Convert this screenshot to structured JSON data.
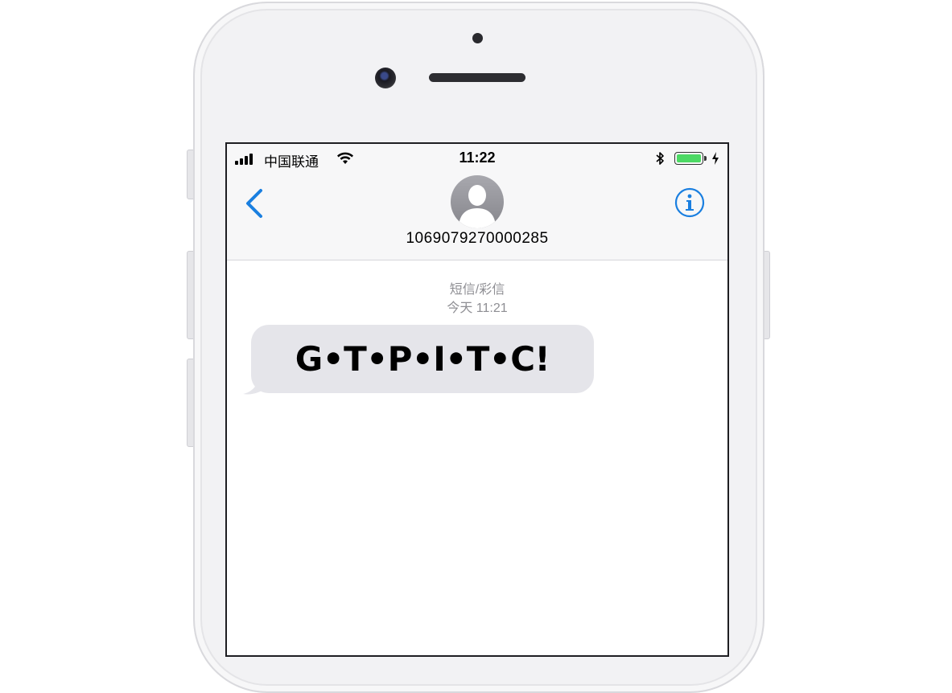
{
  "status_bar": {
    "carrier": "中国联通",
    "time": "11:22"
  },
  "header": {
    "contact_number": "1069079270000285"
  },
  "conversation": {
    "message_type": "短信/彩信",
    "timestamp": "今天 11:21",
    "messages": [
      {
        "text": "G•T•P•I•T•C!",
        "direction": "incoming"
      }
    ]
  },
  "colors": {
    "accent": "#1a7fe0",
    "bubble_incoming": "#e5e5ea",
    "battery": "#4cd964",
    "meta_text": "#8e8e93"
  },
  "icons": {
    "back": "chevron-left-icon",
    "info": "info-icon",
    "avatar": "person-silhouette-icon",
    "wifi": "wifi-icon",
    "bluetooth": "bluetooth-icon",
    "battery": "battery-icon",
    "charging": "bolt-icon",
    "signal": "signal-bars-icon"
  }
}
